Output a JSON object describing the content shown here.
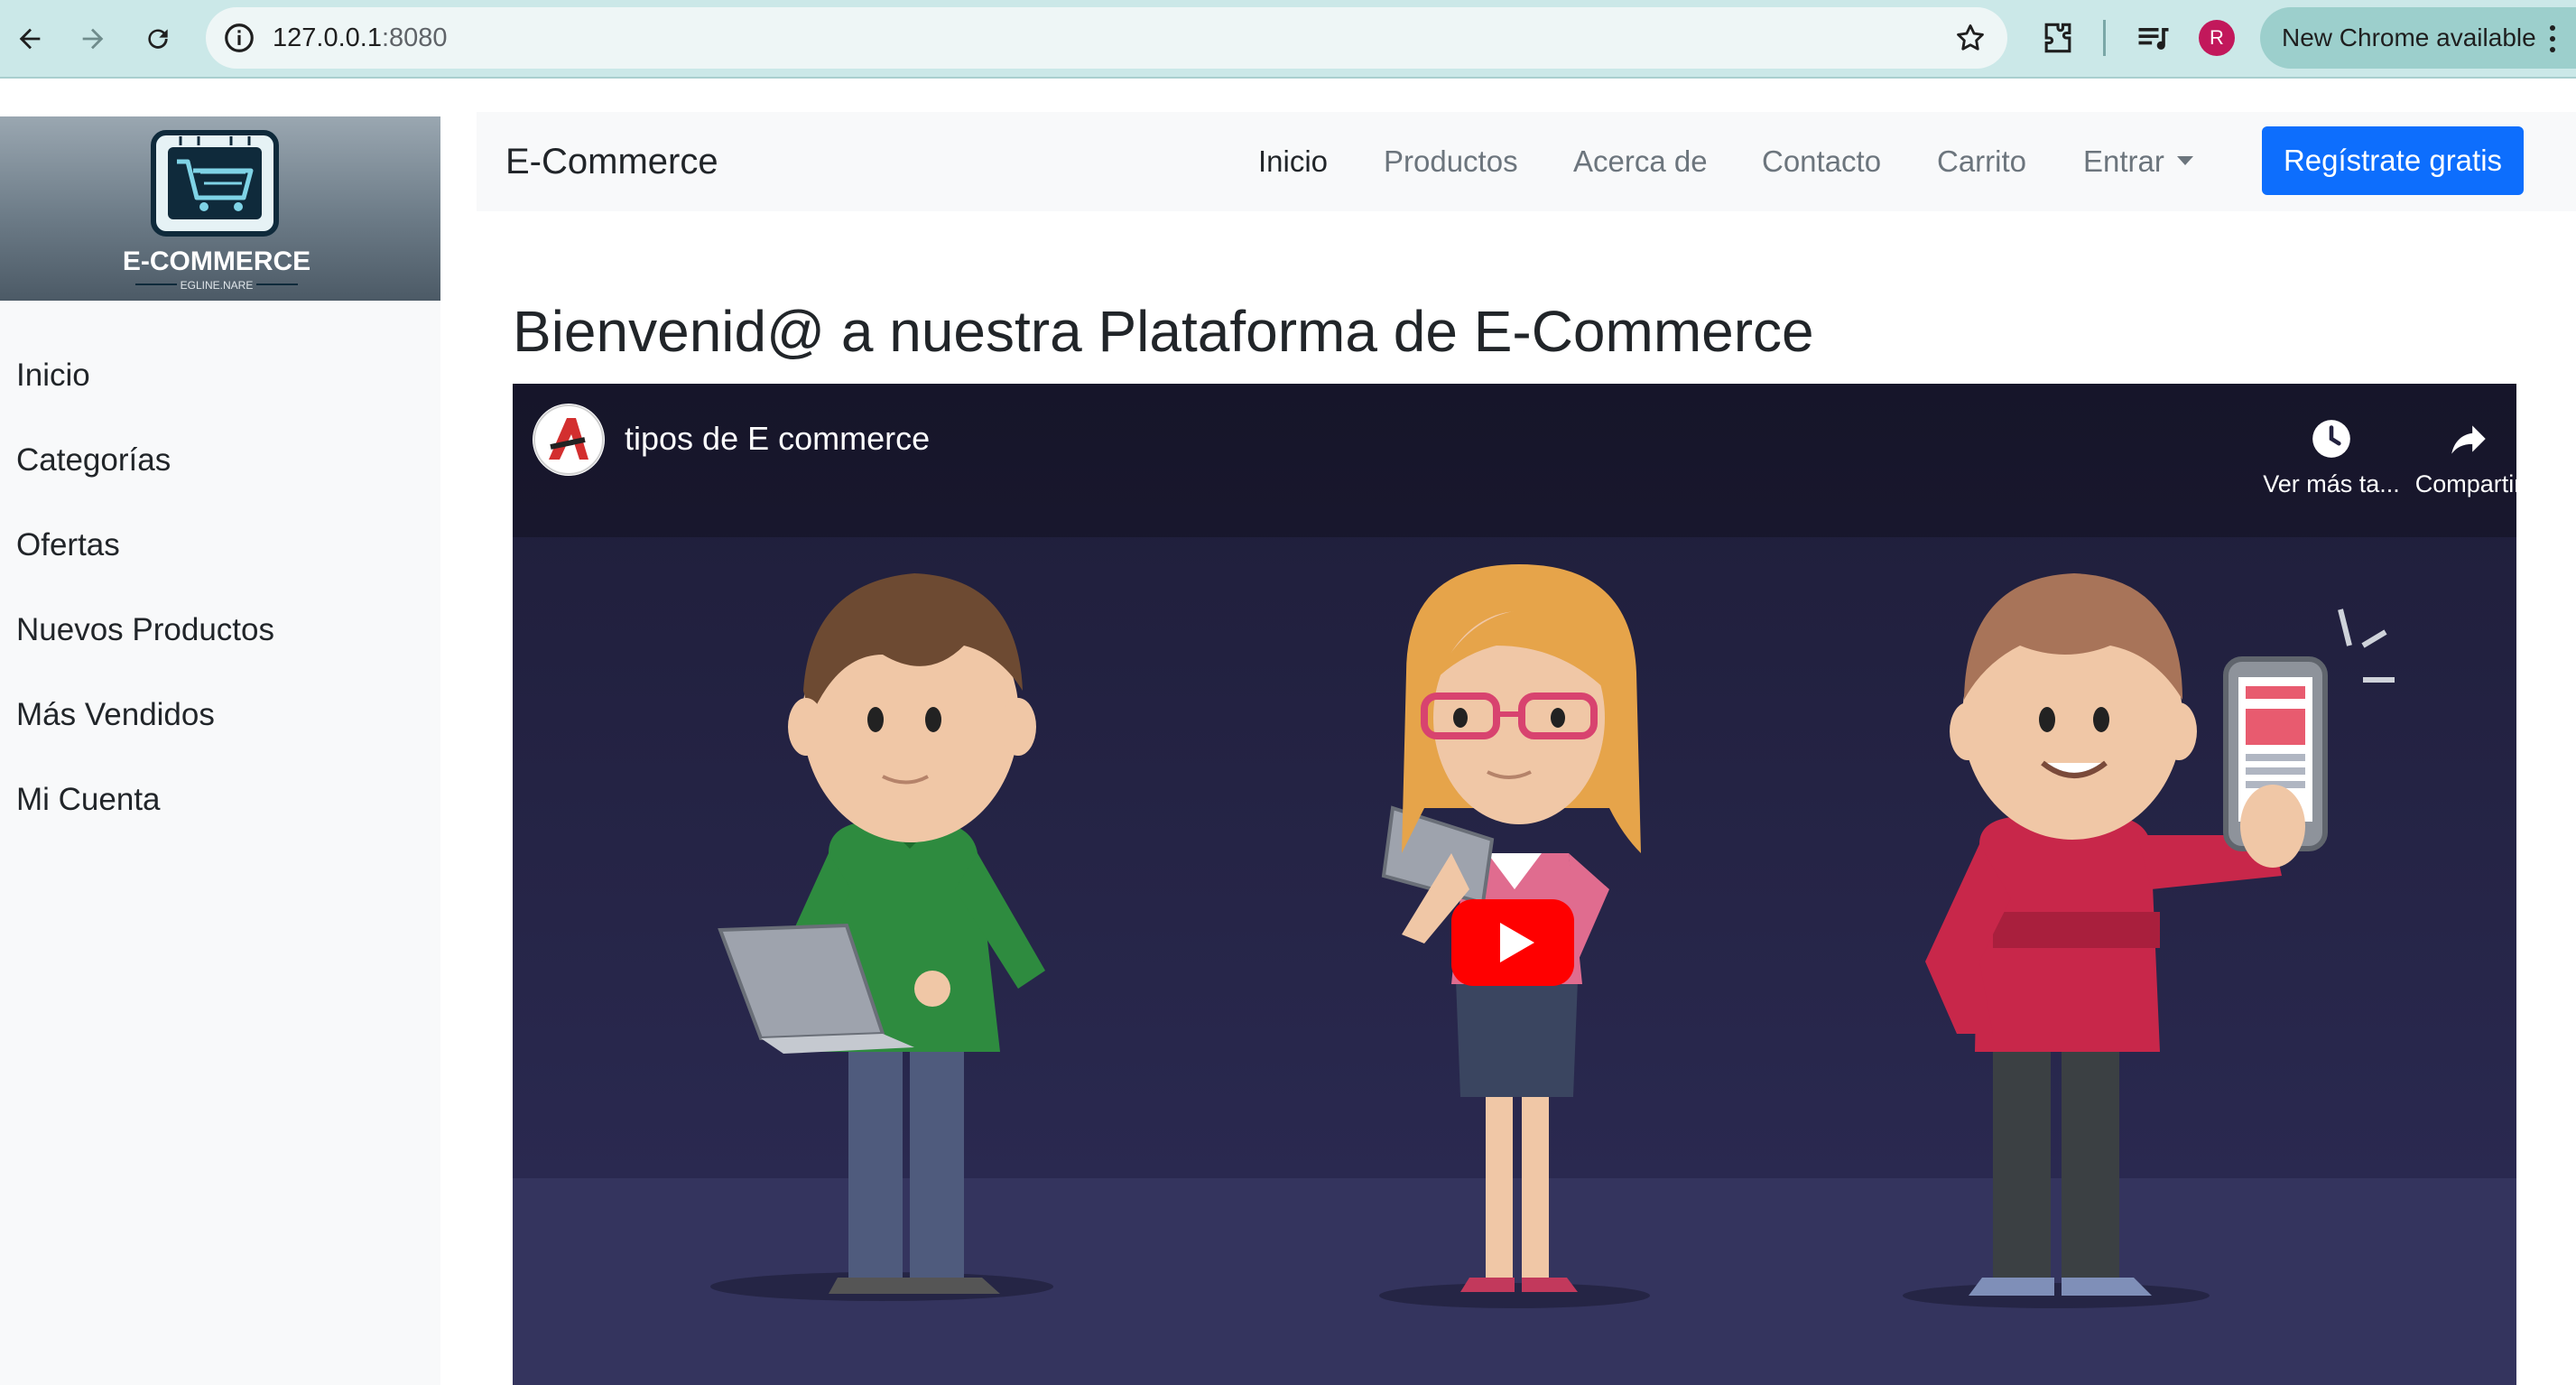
{
  "browser": {
    "url_host": "127.0.0.1",
    "url_port": ":8080",
    "profile_initial": "R",
    "update_label": "New Chrome available",
    "icons": [
      "back-arrow-icon",
      "forward-arrow-icon",
      "reload-icon",
      "site-info-icon",
      "bookmark-star-icon",
      "extensions-icon",
      "media-controls-icon",
      "more-menu-icon"
    ]
  },
  "sidebar": {
    "logo_text": "E-COMMERCE",
    "logo_subtext": "EGLINE.NARE",
    "items": [
      {
        "label": "Inicio"
      },
      {
        "label": "Categorías"
      },
      {
        "label": "Ofertas"
      },
      {
        "label": "Nuevos Productos"
      },
      {
        "label": "Más Vendidos"
      },
      {
        "label": "Mi Cuenta"
      }
    ]
  },
  "navbar": {
    "brand": "E-Commerce",
    "links": [
      {
        "label": "Inicio",
        "active": true
      },
      {
        "label": "Productos"
      },
      {
        "label": "Acerca de"
      },
      {
        "label": "Contacto"
      },
      {
        "label": "Carrito"
      },
      {
        "label": "Entrar"
      }
    ],
    "signup_label": "Regístrate gratis",
    "accent": "#0d6efd"
  },
  "main": {
    "heading": "Bienvenid@ a nuestra Plataforma de E-Commerce"
  },
  "video": {
    "title": "tipos de E commerce",
    "watch_later_label": "Ver más ta...",
    "share_label": "Compartir",
    "play_color": "#ff0000"
  }
}
